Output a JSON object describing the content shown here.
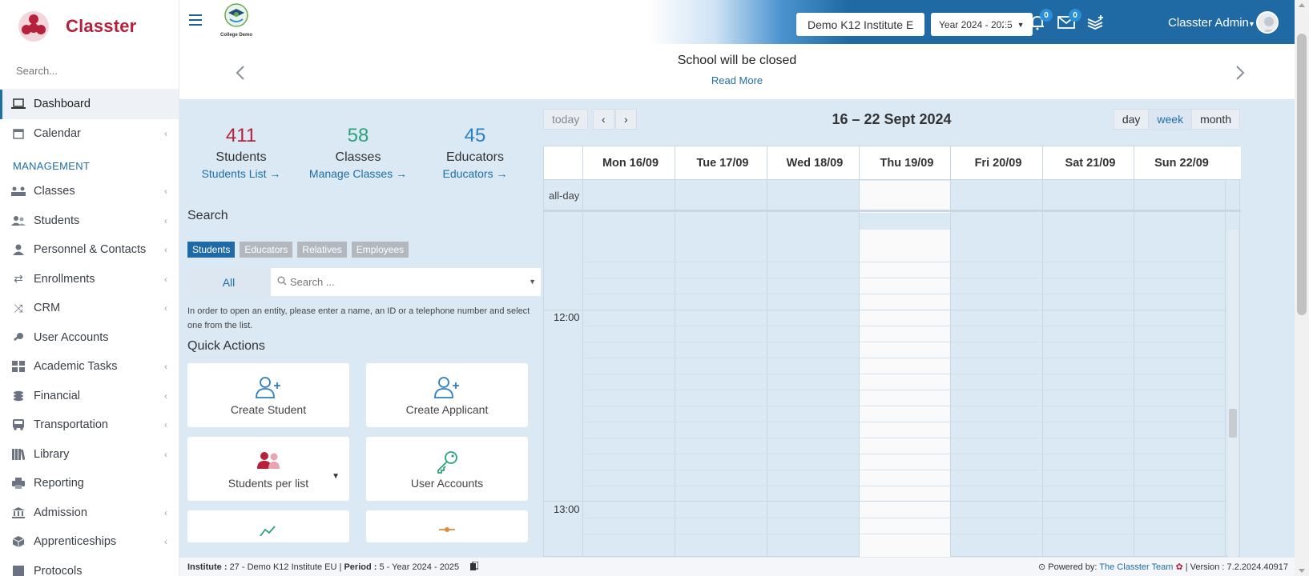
{
  "brand": {
    "name": "Classter"
  },
  "sidebar": {
    "search_placeholder": "Search...",
    "items_top": [
      {
        "label": "Dashboard",
        "icon": "laptop-icon",
        "active": true
      },
      {
        "label": "Calendar",
        "icon": "calendar-icon"
      }
    ],
    "heading": "MANAGEMENT",
    "items": [
      {
        "label": "Classes",
        "icon": "classes-icon"
      },
      {
        "label": "Students",
        "icon": "students-icon"
      },
      {
        "label": "Personnel & Contacts",
        "icon": "person-icon"
      },
      {
        "label": "Enrollments",
        "icon": "swap-icon"
      },
      {
        "label": "CRM",
        "icon": "shuffle-icon"
      },
      {
        "label": "User Accounts",
        "icon": "key-icon"
      },
      {
        "label": "Academic Tasks",
        "icon": "grid-icon"
      },
      {
        "label": "Financial",
        "icon": "coins-icon"
      },
      {
        "label": "Transportation",
        "icon": "bus-icon"
      },
      {
        "label": "Library",
        "icon": "books-icon"
      },
      {
        "label": "Reporting",
        "icon": "printer-icon"
      },
      {
        "label": "Admission",
        "icon": "bank-icon"
      },
      {
        "label": "Apprenticeships",
        "icon": "box-icon"
      },
      {
        "label": "Protocols",
        "icon": "protocol-icon"
      }
    ]
  },
  "topbar": {
    "college_logo_text": "College Demo",
    "institute": "Demo K12 Institute E",
    "year": "Year 2024 - 2025",
    "notifications_count": "0",
    "messages_count": "0",
    "user_name": "Classter Admin"
  },
  "announcement": {
    "title": "School will be closed",
    "link": "Read More"
  },
  "stats": [
    {
      "value": "411",
      "label": "Students",
      "link": "Students List →",
      "color": "#b5213a"
    },
    {
      "value": "58",
      "label": "Classes",
      "link": "Manage Classes →",
      "color": "#2aa37a"
    },
    {
      "value": "45",
      "label": "Educators",
      "link": "Educators →",
      "color": "#2b7fc4"
    }
  ],
  "search": {
    "heading": "Search",
    "chips": [
      "Students",
      "Educators",
      "Relatives",
      "Employees"
    ],
    "scope": "All",
    "placeholder": "Search ...",
    "help": "In order to open an entity, please enter a name, an ID or a telephone number and select one from the list."
  },
  "quick_actions": {
    "heading": "Quick Actions",
    "items": [
      {
        "label": "Create Student",
        "icon": "add-user-icon"
      },
      {
        "label": "Create Applicant",
        "icon": "add-user-icon"
      },
      {
        "label": "Students per list",
        "icon": "users-icon"
      },
      {
        "label": "User Accounts",
        "icon": "key-icon"
      }
    ]
  },
  "calendar": {
    "today_label": "today",
    "prev_label": "‹",
    "next_label": "›",
    "title": "16 – 22 Sept 2024",
    "views": [
      "day",
      "week",
      "month"
    ],
    "active_view": "week",
    "days": [
      "Mon 16/09",
      "Tue 17/09",
      "Wed 18/09",
      "Thu 19/09",
      "Fri 20/09",
      "Sat 21/09",
      "Sun 22/09"
    ],
    "allday_label": "all-day",
    "times": [
      "12:00",
      "13:00"
    ]
  },
  "footer": {
    "institute_label": "Institute :",
    "institute_value": "27 - Demo K12 Institute EU",
    "period_label": "Period :",
    "period_value": "5 - Year 2024 - 2025",
    "powered_label": "Powered by:",
    "powered_link": "The Classter Team",
    "version": "| Version : 7.2.2024.40917"
  }
}
